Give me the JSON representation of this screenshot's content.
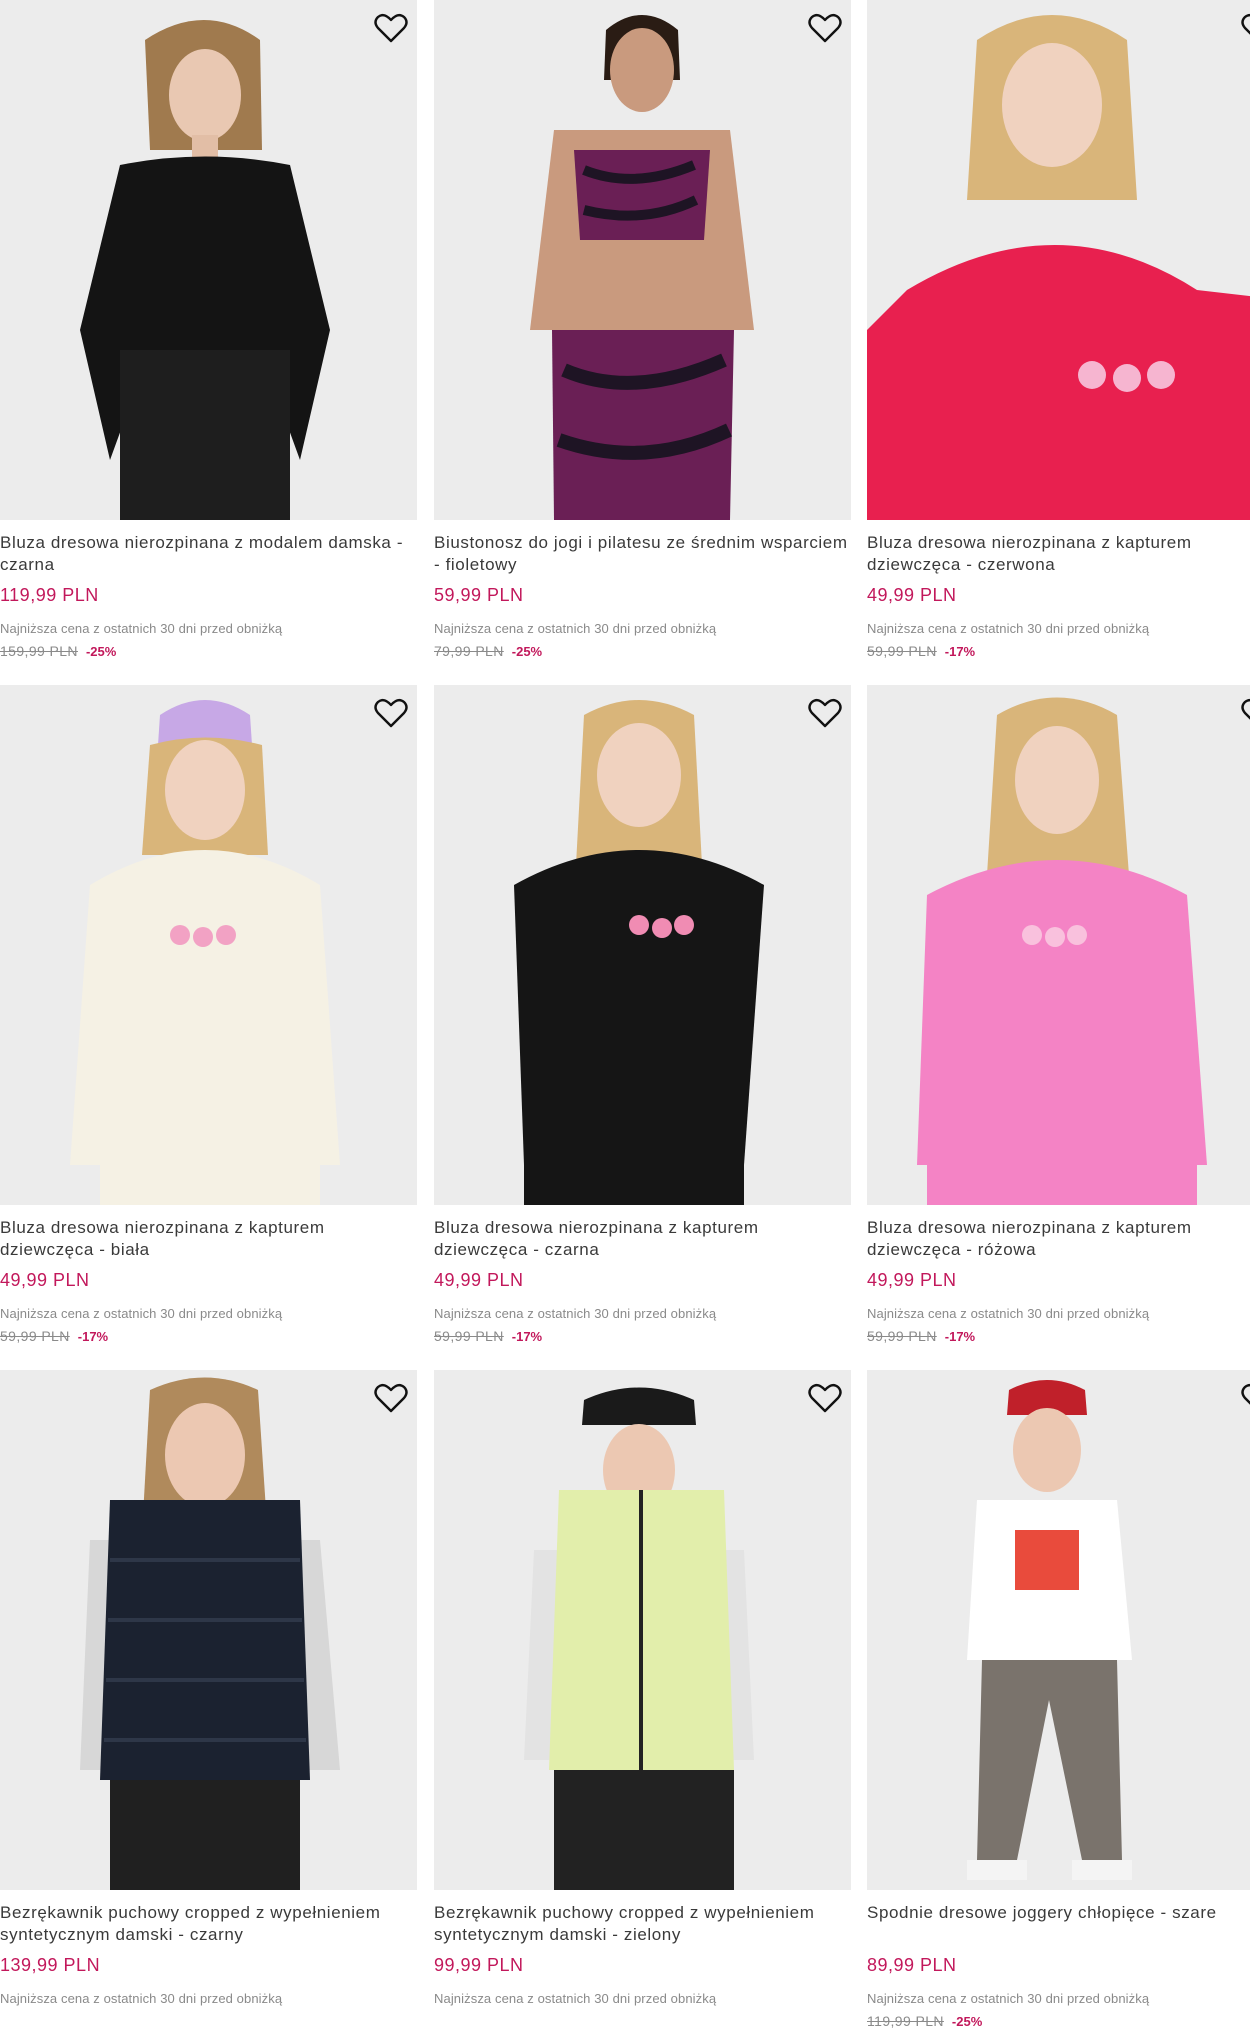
{
  "accent": "#c2185b",
  "lowest_price_note": "Najniższa cena z ostatnich 30 dni przed obniżką",
  "favorite_icon": "heart-outline-icon",
  "products": [
    {
      "name": "Bluza dresowa nierozpinana z modalem damska - czarna",
      "price": "119,99 PLN",
      "lowest_note": "Najniższa cena z ostatnich 30 dni przed obniżką",
      "old_price": "159,99 PLN",
      "discount": "-25%"
    },
    {
      "name": "Biustonosz do jogi i pilatesu ze średnim wsparciem - fioletowy",
      "price": "59,99 PLN",
      "lowest_note": "Najniższa cena z ostatnich 30 dni przed obniżką",
      "old_price": "79,99 PLN",
      "discount": "-25%"
    },
    {
      "name": "Bluza dresowa nierozpinana z kapturem dziewczęca - czerwona",
      "price": "49,99 PLN",
      "lowest_note": "Najniższa cena z ostatnich 30 dni przed obniżką",
      "old_price": "59,99 PLN",
      "discount": "-17%"
    },
    {
      "name": "Bluza dresowa nierozpinana z kapturem dziewczęca - biała",
      "price": "49,99 PLN",
      "lowest_note": "Najniższa cena z ostatnich 30 dni przed obniżką",
      "old_price": "59,99 PLN",
      "discount": "-17%"
    },
    {
      "name": "Bluza dresowa nierozpinana z kapturem dziewczęca - czarna",
      "price": "49,99 PLN",
      "lowest_note": "Najniższa cena z ostatnich 30 dni przed obniżką",
      "old_price": "59,99 PLN",
      "discount": "-17%"
    },
    {
      "name": "Bluza dresowa nierozpinana z kapturem dziewczęca - różowa",
      "price": "49,99 PLN",
      "lowest_note": "Najniższa cena z ostatnich 30 dni przed obniżką",
      "old_price": "59,99 PLN",
      "discount": "-17%"
    },
    {
      "name": "Bezrękawnik puchowy cropped z wypełnieniem syntetycznym damski - czarny",
      "price": "139,99 PLN",
      "lowest_note": "Najniższa cena z ostatnich 30 dni przed obniżką",
      "old_price": "",
      "discount": ""
    },
    {
      "name": "Bezrękawnik puchowy cropped z wypełnieniem syntetycznym damski - zielony",
      "price": "99,99 PLN",
      "lowest_note": "Najniższa cena z ostatnich 30 dni przed obniżką",
      "old_price": "",
      "discount": ""
    },
    {
      "name": "Spodnie dresowe joggery chłopięce - szare",
      "price": "89,99 PLN",
      "lowest_note": "Najniższa cena z ostatnich 30 dni przed obniżką",
      "old_price": "119,99 PLN",
      "discount": "-25%"
    }
  ]
}
